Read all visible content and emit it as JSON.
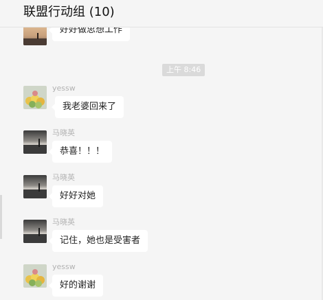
{
  "header": {
    "title": "联盟行动组 (10)"
  },
  "chat": {
    "timestamp": "上午 8:46",
    "messages": [
      {
        "sender": "",
        "text": "好好做思想工作",
        "avatar": "sunset-avatar"
      },
      {
        "sender": "yessw",
        "text": "我老婆回来了",
        "avatar": "balloons-avatar"
      },
      {
        "sender": "马晓英",
        "text": "恭喜！！！",
        "avatar": "sunset-avatar"
      },
      {
        "sender": "马晓英",
        "text": "好好对她",
        "avatar": "sunset-avatar"
      },
      {
        "sender": "马晓英",
        "text": "记住，她也是受害者",
        "avatar": "sunset-avatar"
      },
      {
        "sender": "yessw",
        "text": "好的谢谢",
        "avatar": "balloons-avatar"
      }
    ]
  },
  "colors": {
    "background": "#f5f5f5",
    "bubble": "#ffffff",
    "sender_text": "#b2b2b2",
    "timestamp_bg": "#dadada"
  }
}
